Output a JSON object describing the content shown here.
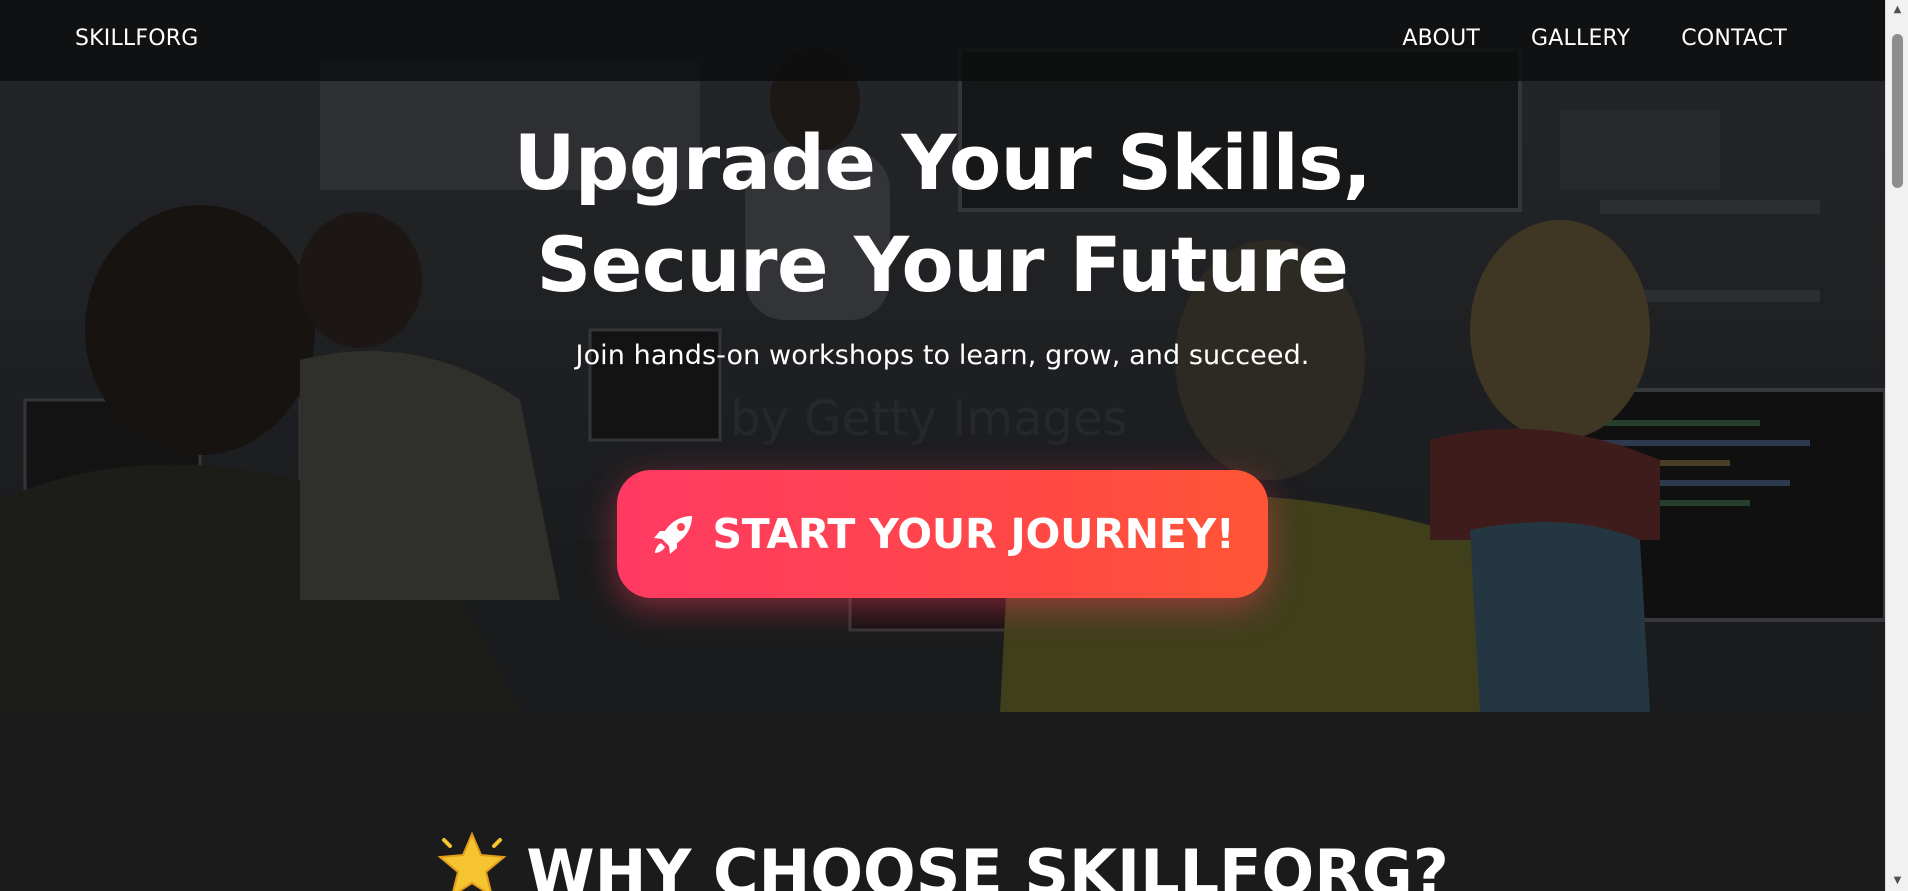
{
  "nav": {
    "brand": "SKILLFORG",
    "links": [
      {
        "label": "ABOUT"
      },
      {
        "label": "GALLERY"
      },
      {
        "label": "CONTACT"
      }
    ]
  },
  "hero": {
    "title_line1": "Upgrade Your Skills,",
    "title_line2": "Secure Your Future",
    "subtitle": "Join hands-on workshops to learn, grow, and succeed.",
    "background_watermark": "by Getty Images",
    "cta": {
      "icon": "rocket-icon",
      "label": "START YOUR JOURNEY!"
    }
  },
  "features": {
    "heading_icon": "star-icon",
    "heading": "WHY CHOOSE SKILLFORG?"
  },
  "colors": {
    "cta_gradient_start": "#ff3a63",
    "cta_gradient_end": "#ff5535",
    "page_background": "#1b1b1c",
    "nav_background": "#0c0d0e"
  }
}
